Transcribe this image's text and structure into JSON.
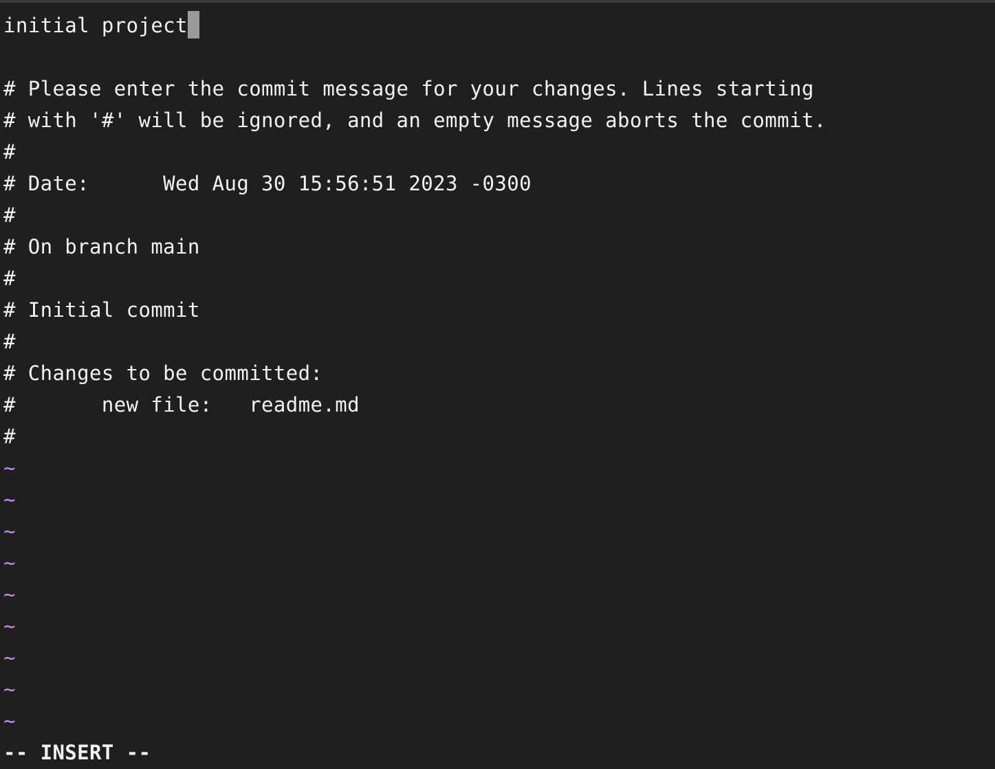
{
  "editor": {
    "first_line": "initial project",
    "comment_lines": [
      "# Please enter the commit message for your changes. Lines starting",
      "# with '#' will be ignored, and an empty message aborts the commit.",
      "#",
      "# Date:      Wed Aug 30 15:56:51 2023 -0300",
      "#",
      "# On branch main",
      "#",
      "# Initial commit",
      "#",
      "# Changes to be committed:",
      "#       new file:   readme.md",
      "#"
    ],
    "empty_marker": "~",
    "empty_marker_color": "#c58af0"
  },
  "status": {
    "mode": "-- INSERT --"
  }
}
